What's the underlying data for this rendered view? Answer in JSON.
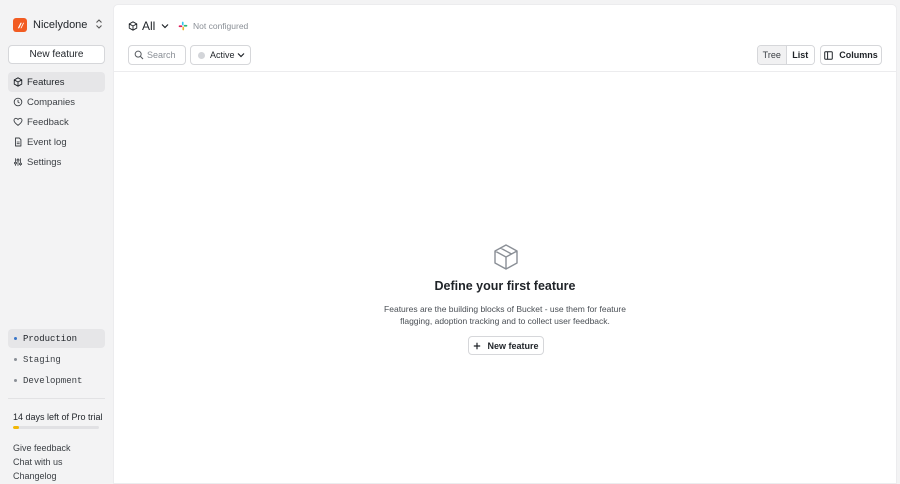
{
  "org": {
    "name": "Nicelydone"
  },
  "sidebar": {
    "new_feature_label": "New feature",
    "nav": [
      {
        "label": "Features",
        "icon": "cube-icon",
        "active": true
      },
      {
        "label": "Companies",
        "icon": "clock-icon"
      },
      {
        "label": "Feedback",
        "icon": "heart-icon"
      },
      {
        "label": "Event log",
        "icon": "document-icon"
      },
      {
        "label": "Settings",
        "icon": "sliders-icon"
      }
    ],
    "environments": [
      {
        "label": "Production",
        "active": true
      },
      {
        "label": "Staging"
      },
      {
        "label": "Development"
      }
    ],
    "trial": {
      "text": "14 days left of Pro trial",
      "progress_fraction": 0.07
    },
    "footer": {
      "give_feedback": "Give feedback",
      "chat": "Chat with us",
      "changelog": "Changelog"
    }
  },
  "header": {
    "filter_label": "All",
    "integration_status": "Not configured"
  },
  "toolbar": {
    "search_placeholder": "Search",
    "status_filter": "Active",
    "view_tree": "Tree",
    "view_list": "List",
    "columns_label": "Columns"
  },
  "empty_state": {
    "title": "Define your first feature",
    "description": "Features are the building blocks of Bucket - use them for feature flagging, adoption tracking and to collect user feedback.",
    "button_label": "New feature"
  },
  "colors": {
    "brand": "#f25c22",
    "trial_progress": "#f2b705",
    "active_env_dot": "#3a76c9"
  }
}
